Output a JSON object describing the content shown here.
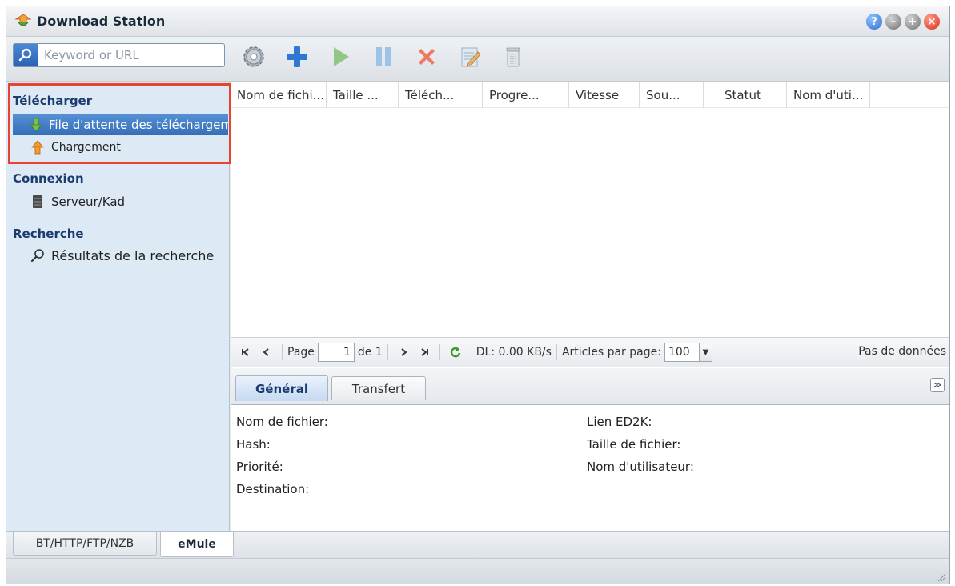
{
  "window": {
    "title": "Download Station"
  },
  "toolbar": {
    "search_placeholder": "Keyword or URL",
    "tools": [
      "settings-icon",
      "add-icon",
      "play-icon",
      "pause-icon",
      "delete-icon",
      "edit-icon",
      "clear-icon"
    ]
  },
  "sidebar": {
    "sections": [
      {
        "title": "Télécharger",
        "items": [
          {
            "label": "File d'attente des téléchargements",
            "icon": "download-arrow-icon",
            "selected": true
          },
          {
            "label": "Chargement",
            "icon": "upload-arrow-icon",
            "selected": false
          }
        ]
      },
      {
        "title": "Connexion",
        "items": [
          {
            "label": "Serveur/Kad",
            "icon": "server-icon",
            "selected": false
          }
        ]
      },
      {
        "title": "Recherche",
        "items": [
          {
            "label": "Résultats de la recherche",
            "icon": "magnifier-icon",
            "selected": false
          }
        ]
      }
    ]
  },
  "grid": {
    "columns": [
      "Nom de fichi...",
      "Taille ...",
      "Téléch...",
      "Progre...",
      "Vitesse",
      "Sou...",
      "Statut",
      "Nom d'uti..."
    ]
  },
  "pager": {
    "page_label": "Page",
    "page_value": "1",
    "of_label": "de 1",
    "dl_rate": "DL: 0.00 KB/s",
    "per_page_label": "Articles par page:",
    "per_page_value": "100",
    "status": "Pas de données"
  },
  "details": {
    "tabs": [
      "Général",
      "Transfert"
    ],
    "active_tab": "Général",
    "left_fields": [
      "Nom de fichier:",
      "Hash:",
      "Priorité:",
      "Destination:"
    ],
    "right_fields": [
      "Lien ED2K:",
      "Taille de fichier:",
      "Nom d'utilisateur:"
    ]
  },
  "bottom_tabs": {
    "items": [
      "BT/HTTP/FTP/NZB",
      "eMule"
    ],
    "active": "eMule"
  },
  "colors": {
    "accent": "#346fb8",
    "highlight": "#e8432d",
    "sidebar_bg": "#dde9f5"
  }
}
